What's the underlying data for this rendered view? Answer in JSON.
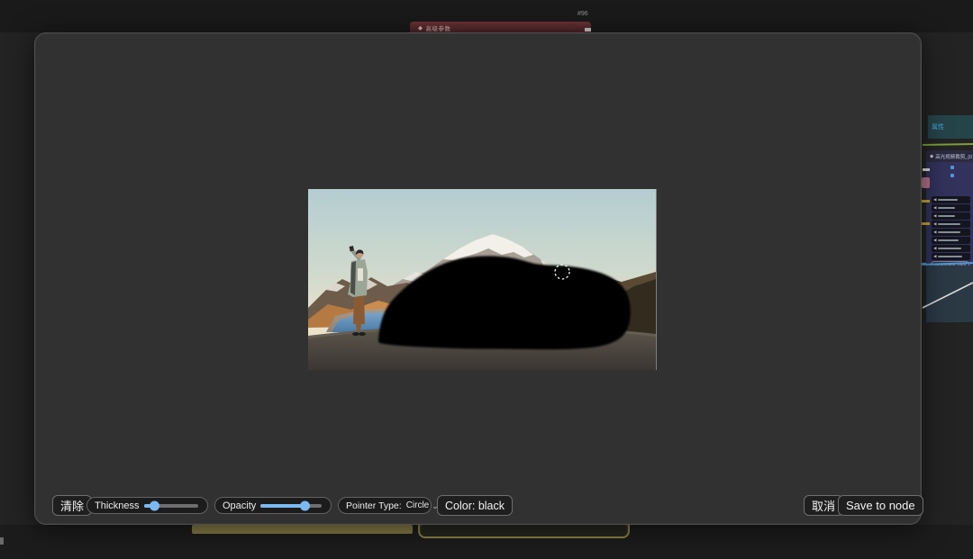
{
  "icons": {
    "chevron_down": "⌄",
    "diamond": "◆",
    "widget_arrow": "◀"
  },
  "mask_editor": {
    "toolbar": {
      "clear": "清除",
      "thickness": {
        "label": "Thickness",
        "percent": 18
      },
      "opacity": {
        "label": "Opacity",
        "percent": 70
      },
      "pointer_type": {
        "label": "Pointer Type:",
        "value": "Circle"
      },
      "color": "Color: black",
      "cancel": "取消",
      "save": "Save to node"
    },
    "canvas": {
      "brush_shape": "Circle",
      "mask_color": "black"
    }
  },
  "graph": {
    "top_node": {
      "badge": "#96",
      "title": "高级参数"
    },
    "right_node": {
      "header": "属性",
      "title": "高光视频裁剪_(0",
      "footer_pill": "background_color"
    }
  }
}
